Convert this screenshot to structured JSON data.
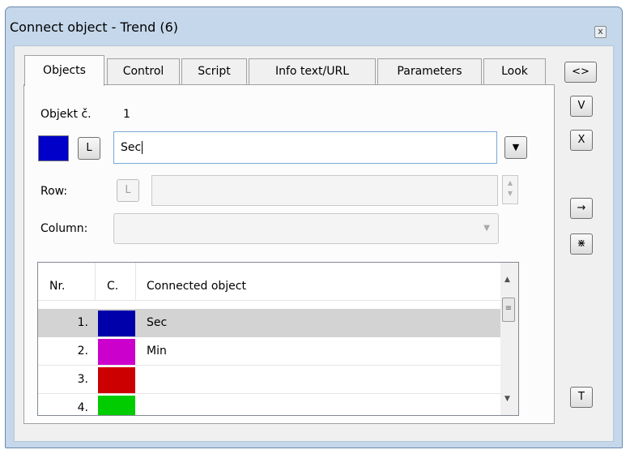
{
  "window": {
    "title": "Connect object - Trend (6)",
    "close_label": "x"
  },
  "tabs": [
    {
      "label": "Objects",
      "active": true
    },
    {
      "label": "Control"
    },
    {
      "label": "Script"
    },
    {
      "label": "Info text/URL"
    },
    {
      "label": "Parameters"
    },
    {
      "label": "Look"
    }
  ],
  "objects": {
    "object_label": "Objekt č.",
    "object_number": "1",
    "color": "#0000c8",
    "l_button": "L",
    "object_name_value": "Sec",
    "row_label": "Row:",
    "row_l_button": "L",
    "column_label": "Column:",
    "list": {
      "headers": [
        "Nr.",
        "C.",
        "Connected object"
      ],
      "rows": [
        {
          "nr": "1.",
          "color": "#0000aa",
          "name": "Sec",
          "selected": true
        },
        {
          "nr": "2.",
          "color": "#cc00cc",
          "name": "Min"
        },
        {
          "nr": "3.",
          "color": "#cc0000",
          "name": ""
        },
        {
          "nr": "4.",
          "color": "#00cc00",
          "name": ""
        }
      ]
    }
  },
  "side_buttons": {
    "swap": "<>",
    "v": "V",
    "x": "X",
    "arrow": "→",
    "split": "⋇",
    "t": "T"
  }
}
